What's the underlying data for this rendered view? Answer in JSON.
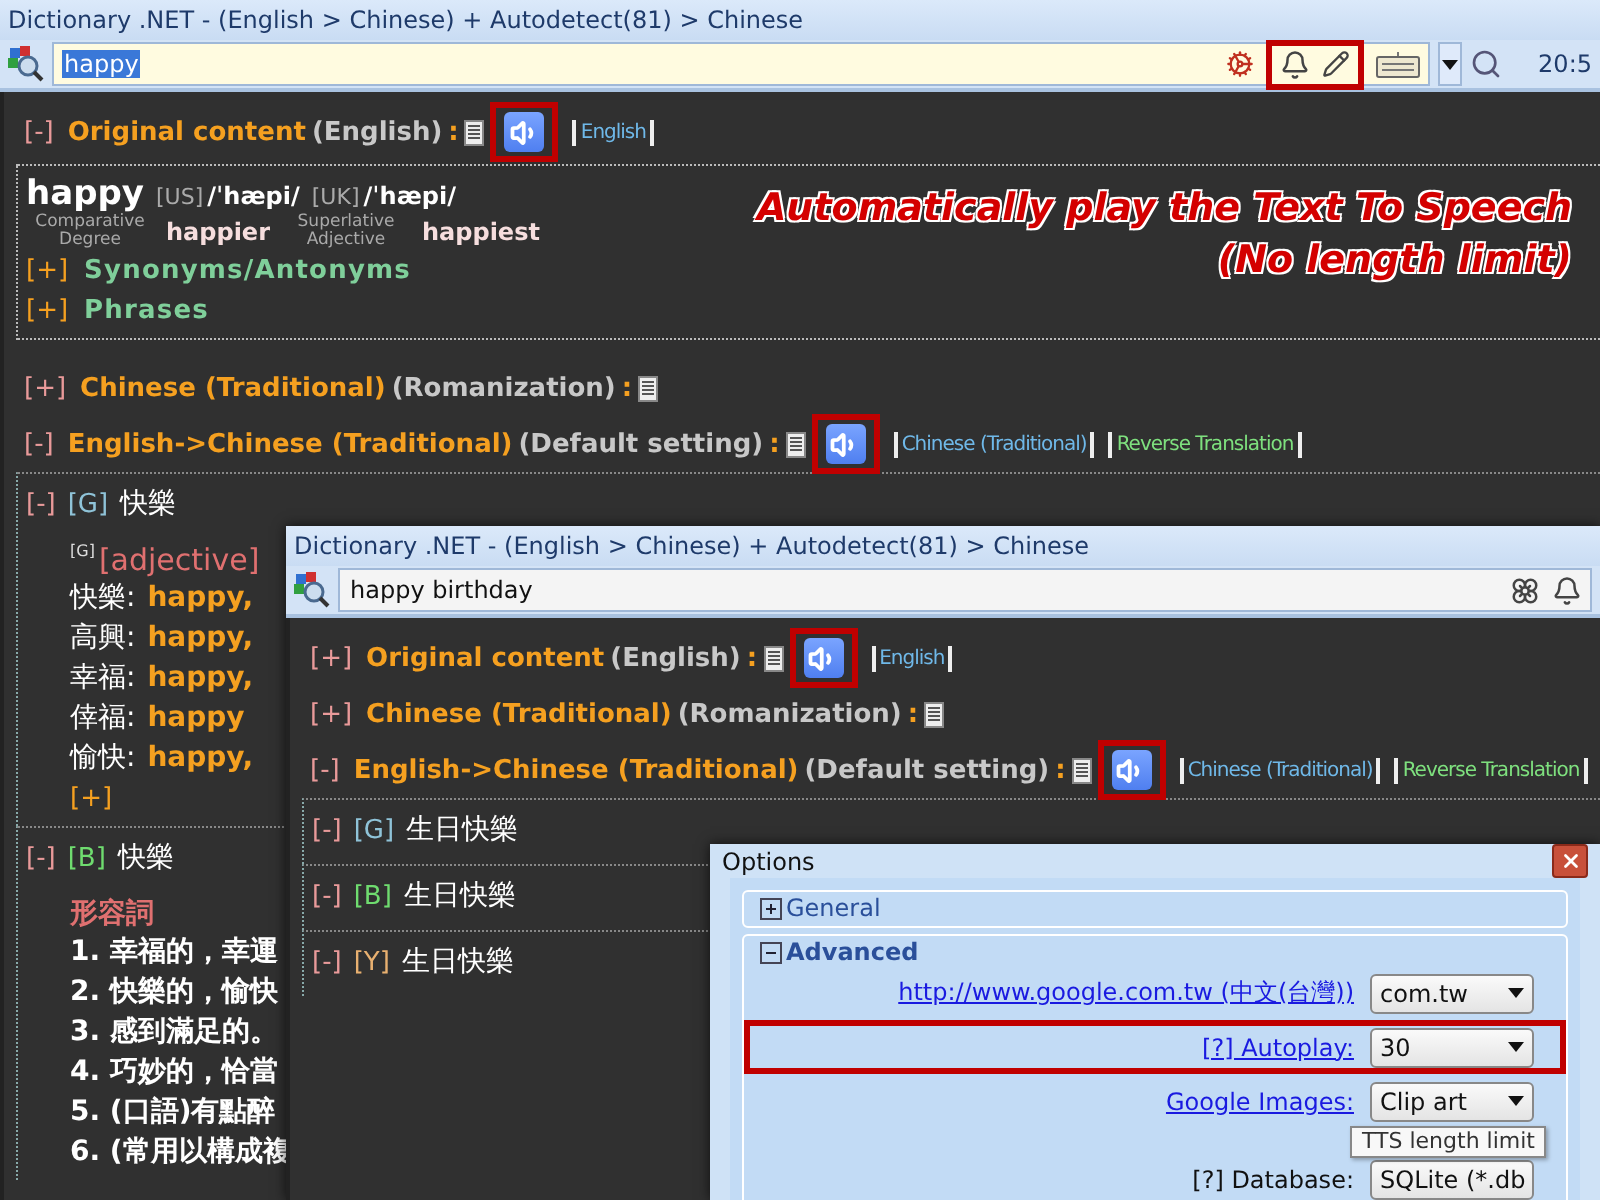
{
  "main_window": {
    "title": "Dictionary .NET - (English > Chinese) + Autodetect(81) > Chinese",
    "search": {
      "value": "happy",
      "selected": true
    },
    "toolbar_highlighted": true,
    "clock": "20:5",
    "blocks": [
      {
        "kind": "header",
        "toggle": "[-]",
        "title": "Original content",
        "lang": "(English)",
        "suffix": ":",
        "speaker": {
          "highlighted": true
        },
        "tags": [
          {
            "label": "English",
            "color": "#6fb8e8"
          }
        ]
      },
      {
        "kind": "entry",
        "word": "happy",
        "pronunciations": [
          {
            "region": "[US]",
            "ipa": "/ˈhæpi/"
          },
          {
            "region": "[UK]",
            "ipa": "/ˈhæpi/"
          }
        ],
        "forms": [
          {
            "label": "Comparative Degree",
            "word": "happier"
          },
          {
            "label": "Superlative Adjective",
            "word": "happiest"
          }
        ],
        "links": [
          {
            "toggle": "[+]",
            "label": "Synonyms/Antonyms"
          },
          {
            "toggle": "[+]",
            "label": "Phrases"
          }
        ],
        "callout": [
          "Automatically play the Text To Speech",
          "(No length limit)"
        ]
      },
      {
        "kind": "header",
        "toggle": "[+]",
        "title": "Chinese (Traditional)",
        "lang": "(Romanization)",
        "suffix": ":"
      },
      {
        "kind": "header",
        "toggle": "[-]",
        "title": "English->Chinese (Traditional)",
        "lang": "(Default setting)",
        "suffix": ":",
        "speaker": {
          "highlighted": true
        },
        "tags": [
          {
            "label": "Chinese (Traditional)",
            "color": "#6fb8e8"
          },
          {
            "label": "Reverse Translation",
            "color": "#7ee07e"
          }
        ]
      },
      {
        "kind": "group",
        "toggle": "[-]",
        "tag": "[G]",
        "color": "#8fc3d8",
        "heading": "快樂",
        "pos_mark": "[G]",
        "pos": "[adjective]",
        "lines": [
          {
            "kind": "translation",
            "term": "快樂:",
            "text": "happy,"
          },
          {
            "kind": "translation",
            "term": "高興:",
            "text": "happy,"
          },
          {
            "kind": "translation",
            "term": "幸福:",
            "text": "happy,"
          },
          {
            "kind": "translation",
            "term": "倖福:",
            "text": "happy"
          },
          {
            "kind": "translation",
            "term": "愉快:",
            "text": "happy,"
          }
        ],
        "more": "[+]"
      },
      {
        "kind": "group",
        "toggle": "[-]",
        "tag": "[B]",
        "color": "#6fdc6f",
        "heading": "快樂",
        "pos": "形容詞",
        "lines": [
          {
            "kind": "sense",
            "text": "1. 幸福的，幸運"
          },
          {
            "kind": "sense",
            "text": "2. 快樂的，愉快"
          },
          {
            "kind": "sense",
            "text": "3. 感到滿足的。"
          },
          {
            "kind": "sense",
            "text": "4. 巧妙的，恰當"
          },
          {
            "kind": "sense",
            "text": "5. (口語)有點醉"
          },
          {
            "kind": "sense",
            "text": "6. (常用以構成複"
          }
        ]
      }
    ]
  },
  "second_window": {
    "title": "Dictionary .NET - (English > Chinese) + Autodetect(81) > Chinese",
    "search": {
      "value": "happy birthday",
      "selected": false
    },
    "blocks": [
      {
        "kind": "header",
        "toggle": "[+]",
        "title": "Original content",
        "lang": "(English)",
        "suffix": ":",
        "speaker": {
          "highlighted": true
        },
        "tags": [
          {
            "label": "English",
            "color": "#6fb8e8"
          }
        ]
      },
      {
        "kind": "header",
        "toggle": "[+]",
        "title": "Chinese (Traditional)",
        "lang": "(Romanization)",
        "suffix": ":"
      },
      {
        "kind": "header",
        "toggle": "[-]",
        "title": "English->Chinese (Traditional)",
        "lang": "(Default setting)",
        "suffix": ":",
        "speaker": {
          "highlighted": true
        },
        "tags": [
          {
            "label": "Chinese (Traditional)",
            "color": "#6fb8e8"
          },
          {
            "label": "Reverse Translation",
            "color": "#7ee07e"
          }
        ]
      },
      {
        "kind": "group",
        "toggle": "[-]",
        "tag": "[G]",
        "color": "#8fc3d8",
        "heading": "生日快樂"
      },
      {
        "kind": "group",
        "toggle": "[-]",
        "tag": "[B]",
        "color": "#6fdc6f",
        "heading": "生日快樂"
      },
      {
        "kind": "group",
        "toggle": "[-]",
        "tag": "[Y]",
        "color": "#e8b070",
        "heading": "生日快樂"
      }
    ]
  },
  "options_dialog": {
    "title": "Options",
    "groups": [
      {
        "label": "General",
        "expanded": false
      },
      {
        "label": "Advanced",
        "expanded": true
      }
    ],
    "rows": [
      {
        "kind": "link",
        "label": "http://www.google.com.tw (中文(台灣))",
        "value": "com.tw",
        "highlighted": false
      },
      {
        "kind": "link",
        "label": "[?] Autoplay:",
        "value": "30",
        "highlighted": true
      },
      {
        "kind": "link",
        "label": "Google Images:",
        "value": "Clip art",
        "highlighted": false,
        "tooltip": "TTS length limit"
      },
      {
        "kind": "plain",
        "label": "[?] Database:",
        "value": "SQLite (*.db",
        "highlighted": false
      }
    ]
  }
}
